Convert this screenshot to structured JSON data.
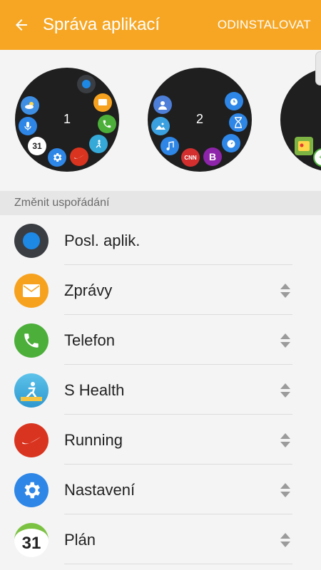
{
  "appbar": {
    "title": "Správa aplikací",
    "action": "ODINSTALOVAT"
  },
  "pages": [
    {
      "number": "1"
    },
    {
      "number": "2"
    }
  ],
  "mini_icons": {
    "calendar_day": "31",
    "cnn": "CNN",
    "b": "B"
  },
  "section": {
    "title": "Změnit uspořádání"
  },
  "apps": [
    {
      "label": "Posl. aplik.",
      "icon": "recent-apps-icon",
      "color": "#3a3d42",
      "reorderable": false
    },
    {
      "label": "Zprávy",
      "icon": "messages-icon",
      "color": "#f6a21f",
      "reorderable": true
    },
    {
      "label": "Telefon",
      "icon": "phone-icon",
      "color": "#4caf3a",
      "reorderable": true
    },
    {
      "label": "S Health",
      "icon": "s-health-icon",
      "color": "#35a9d8",
      "reorderable": true
    },
    {
      "label": "Running",
      "icon": "nike-running-icon",
      "color": "#d9341f",
      "reorderable": true
    },
    {
      "label": "Nastavení",
      "icon": "settings-icon",
      "color": "#2e86e6",
      "reorderable": true
    },
    {
      "label": "Plán",
      "icon": "calendar-icon",
      "color": "#ffffff",
      "day": "31",
      "reorderable": true
    }
  ],
  "colors": {
    "accent": "#f6a623",
    "watch_face": "#1f1f1f"
  }
}
